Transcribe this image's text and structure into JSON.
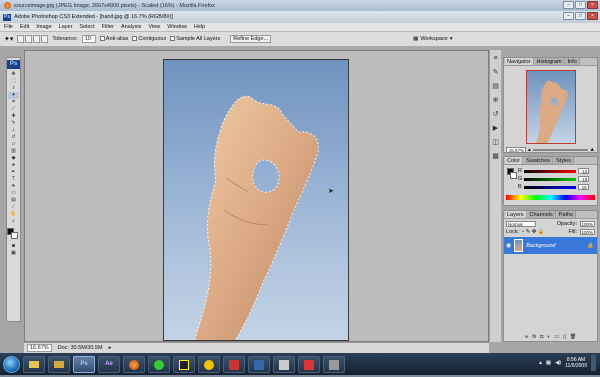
{
  "firefox": {
    "title": "sourceimage.jpg (JPEG Image, 2667x4000 pixels) - Scaled (16%) - Mozilla Firefox"
  },
  "photoshop": {
    "title": "Adobe Photoshop CS3 Extended - [hand.jpg @ 16.7% (RGB/8#)]",
    "logo": "Ps",
    "menu": [
      "File",
      "Edit",
      "Image",
      "Layer",
      "Select",
      "Filter",
      "Analysis",
      "View",
      "Window",
      "Help"
    ],
    "options": {
      "tolerance_label": "Tolerance:",
      "tolerance_value": "10",
      "anti_alias": "Anti-alias",
      "contiguous": "Contiguous",
      "sample_all": "Sample All Layers",
      "refine_edge": "Refine Edge...",
      "workspace": "Workspace"
    },
    "status": {
      "zoom": "16.67%",
      "doc": "Doc: 30.5M/30.5M"
    }
  },
  "panels": {
    "navigator": {
      "tabs": [
        "Navigator",
        "Histogram",
        "Info"
      ],
      "zoom": "16.67%"
    },
    "color": {
      "tabs": [
        "Color",
        "Swatches",
        "Styles"
      ],
      "channels": [
        {
          "label": "R",
          "value": "13",
          "color": "#d62a2a"
        },
        {
          "label": "G",
          "value": "16",
          "color": "#2aa02a"
        },
        {
          "label": "B",
          "value": "16",
          "color": "#2a3ad6"
        }
      ]
    },
    "layers": {
      "tabs": [
        "Layers",
        "Channels",
        "Paths"
      ],
      "blend_mode": "Normal",
      "opacity_label": "Opacity:",
      "opacity": "100%",
      "lock_label": "Lock:",
      "fill_label": "Fill:",
      "fill": "100%",
      "layer_name": "Background"
    }
  },
  "tools": [
    "move-icon",
    "marquee-icon",
    "lasso-icon",
    "magic-wand-icon",
    "crop-icon",
    "slice-icon",
    "healing-icon",
    "brush-icon",
    "stamp-icon",
    "history-brush-icon",
    "eraser-icon",
    "gradient-icon",
    "blur-icon",
    "dodge-icon",
    "pen-icon",
    "type-icon",
    "path-select-icon",
    "shape-icon",
    "notes-icon",
    "eyedropper-icon",
    "hand-icon",
    "zoom-icon"
  ],
  "taskbar": {
    "apps": [
      "",
      "",
      "Ps",
      "Ae",
      "",
      "",
      "",
      "",
      "",
      "",
      "",
      "",
      ""
    ],
    "time": "8:56 AM",
    "date": "11/6/2009"
  },
  "colors": {
    "selection": "#3878d8",
    "accent": "#1c3f8e"
  }
}
